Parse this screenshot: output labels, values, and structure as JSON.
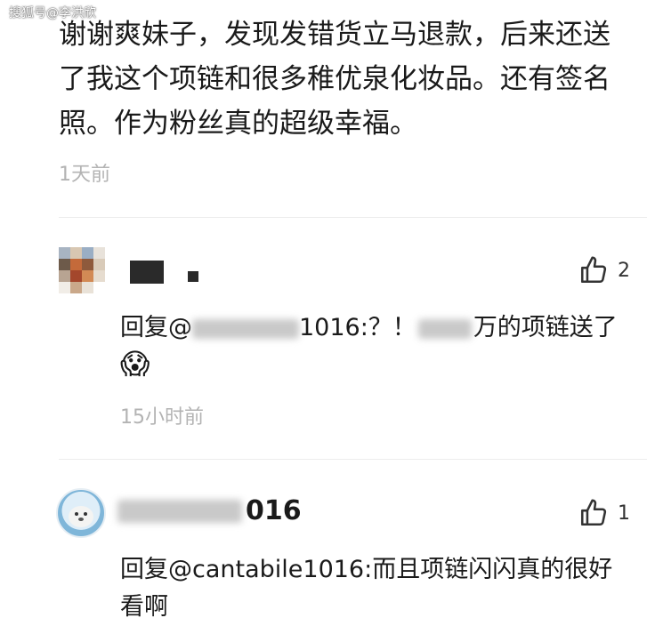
{
  "watermark": "搜狐号@李洪欣",
  "top_comment": {
    "text": "谢谢爽妹子，发现发错货立马退款，后来还送了我这个项链和很多稚优泉化妆品。还有签名照。作为粉丝真的超级幸福。",
    "time": "1天前"
  },
  "comments": [
    {
      "likes": "2",
      "reply_prefix": "回复@",
      "reply_mention_tail": "1016:？！",
      "reply_text": "万的项链送了",
      "emoji": "😱",
      "time": "15小时前"
    },
    {
      "username_tail": "016",
      "likes": "1",
      "reply_text": "回复@cantabile1016:而且项链闪闪真的很好看啊"
    }
  ],
  "colors": {
    "timestamp": "#b3b3b3",
    "divider": "#ececec",
    "text": "#1a1a1a"
  },
  "icons": {
    "like": "thumbs-up-icon"
  }
}
